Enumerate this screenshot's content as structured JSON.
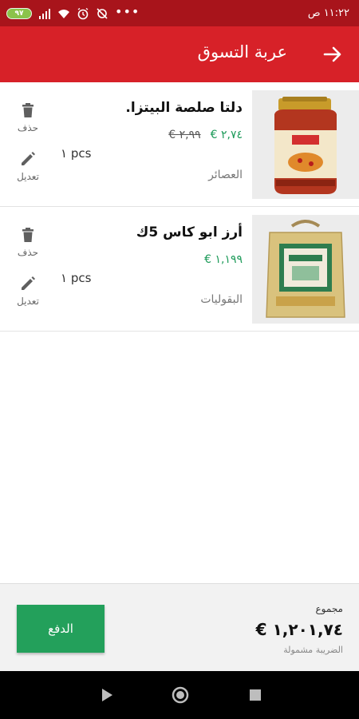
{
  "status_bar": {
    "time": "١١:٢٢ ص",
    "battery": "٩٧",
    "icons": [
      "battery-icon",
      "signal-icon",
      "wifi-icon",
      "alarm-icon",
      "sync-off-icon",
      "more-dots"
    ]
  },
  "app_bar": {
    "title": "عربة التسوق",
    "back_icon": "arrow-right-icon"
  },
  "cart": {
    "items": [
      {
        "name": "دلتا صلصة البيتزا.",
        "old_price": "٢,٩٩ €",
        "price": "٢,٧٤ €",
        "category": "العصائر",
        "quantity": "١ pcs",
        "delete_label": "حذف",
        "edit_label": "تعديل",
        "image": "pizza-sauce-jar"
      },
      {
        "name": "أرز ابو كاس 5ك",
        "price": "١,١٩٩ €",
        "category": "البقوليات",
        "quantity": "١ pcs",
        "delete_label": "حذف",
        "edit_label": "تعديل",
        "image": "rice-sack"
      }
    ]
  },
  "footer": {
    "total_label": "مجموع",
    "total_value": "١,٢٠١,٧٤ €",
    "tax_note": "الضريبة مشمولة",
    "pay_label": "الدفع"
  },
  "colors": {
    "status_bar": "#a8141b",
    "app_bar": "#d72128",
    "price_green": "#1e9b5a",
    "pay_button": "#23a05b"
  }
}
